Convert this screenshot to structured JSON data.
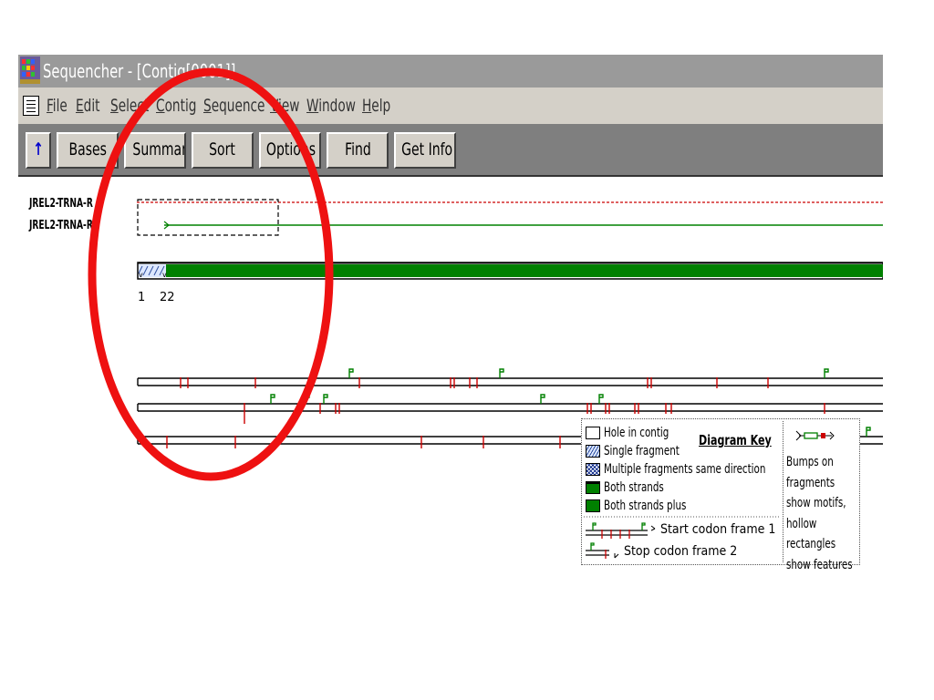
{
  "window": {
    "title": "Sequencher - [Contig[0001]]"
  },
  "menu": {
    "items": [
      "File",
      "Edit",
      "Select",
      "Contig",
      "Sequence",
      "View",
      "Window",
      "Help"
    ]
  },
  "toolbar": {
    "up_arrow": "↑",
    "buttons": [
      "Bases",
      "Summary",
      "Sort",
      "Options",
      "Find",
      "Get Info"
    ]
  },
  "contig": {
    "fragments": [
      "JREL2-TRNA-R",
      "JREL2-TRNA-R"
    ],
    "ruler": {
      "start": "1",
      "mark": "22"
    }
  },
  "key": {
    "title": "Diagram Key",
    "items": [
      "Hole in contig",
      "Single fragment",
      "Multiple fragments same direction",
      "Both strands",
      "Both strands plus"
    ],
    "start_codon": "Start codon frame 1",
    "stop_codon": "Stop codon frame 2",
    "notes": [
      "Bumps on",
      "fragments",
      "show motifs,",
      "hollow",
      "rectangles",
      "show features"
    ]
  },
  "colors": {
    "accent_green": "#008000",
    "stop_red": "#cc0000",
    "highlight_red": "#ee1111",
    "titlebar": "#9a9a9a",
    "menubar": "#d4d0c8",
    "toolbar": "#7f7f7f"
  },
  "icons": [
    "sequencher-app-icon",
    "document-icon",
    "up-arrow-icon"
  ]
}
